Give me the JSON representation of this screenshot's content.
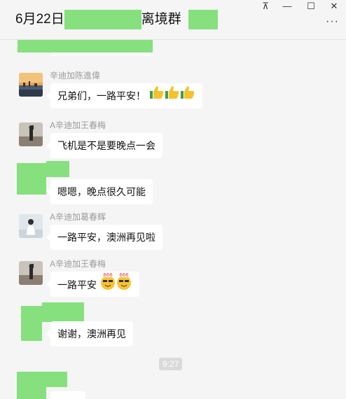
{
  "window": {
    "title_prefix": "6月22日",
    "title_suffix": "离境群",
    "controls": {
      "pin": "⊼",
      "minimize": "—",
      "maximize": "☐",
      "close": "✕"
    },
    "more_icon": "···"
  },
  "messages": [
    {
      "sender": "辛迪加陈進偉",
      "text": "兄弟们，一路平安！",
      "emoji": "thumbs-up-icon",
      "emoji_count": 3
    },
    {
      "sender": "A辛迪加王春梅",
      "text": "飞机是不是要晚点一会"
    },
    {
      "sender": "",
      "text": "嗯嗯，晚点很久可能"
    },
    {
      "sender": "A辛迪加葛春辉",
      "text": "一路平安，澳洲再见啦"
    },
    {
      "sender": "A辛迪加王春梅",
      "text": "一路平安",
      "emoji": "666-face-icon",
      "emoji_count": 2
    },
    {
      "sender": "",
      "text": "谢谢，澳洲再见"
    }
  ],
  "time_divider": "9:27",
  "colors": {
    "redaction": "#86e07e",
    "background": "#f5f5f5",
    "bubble": "#ffffff"
  }
}
